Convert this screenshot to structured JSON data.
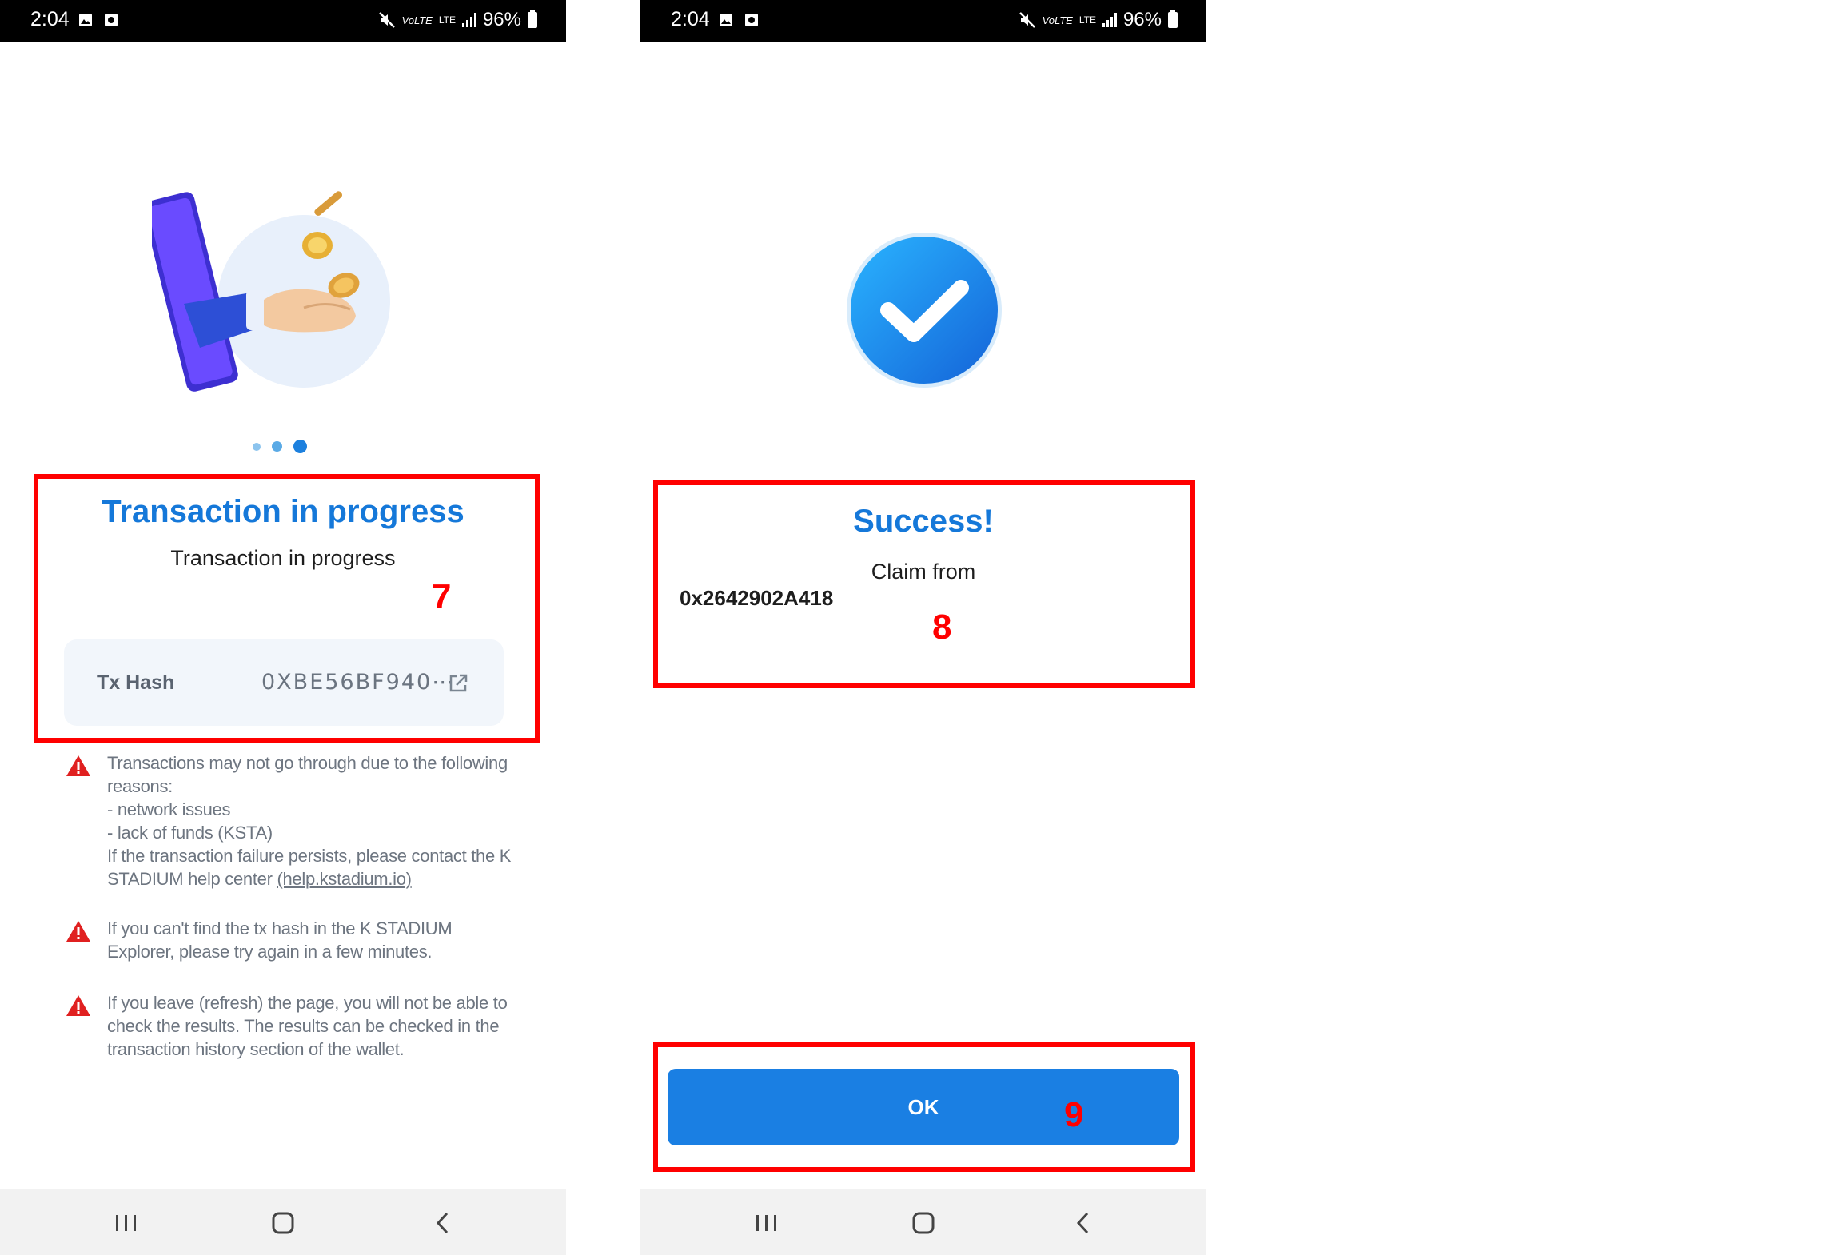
{
  "status_bar": {
    "time": "2:04",
    "volte": "VoLTE",
    "lte": "LTE",
    "battery": "96%"
  },
  "left_screen": {
    "title": "Transaction in progress",
    "subtitle": "Transaction in progress",
    "annotation": "7",
    "tx_hash_label": "Tx Hash",
    "tx_hash_value": "0XBE56BF940⋯",
    "warnings": [
      {
        "text": "Transactions may not go through due to the following reasons:\n- network issues\n- lack of funds (KSTA)\nIf the transaction failure persists, please contact the K STADIUM help center ",
        "link": "(help.kstadium.io)"
      },
      {
        "text": "If you can't find the tx hash in the K STADIUM Explorer, please try again in a few minutes."
      },
      {
        "text": "If you leave (refresh) the page, you will not be able to check the results. The results can be checked in the transaction history section of the wallet."
      }
    ],
    "carousel_active_index": 2,
    "carousel_count": 3
  },
  "right_screen": {
    "title": "Success!",
    "subtitle": "Claim from",
    "address": "0x2642902A418",
    "annotation": "8",
    "ok_label": "OK",
    "ok_annotation": "9"
  },
  "colors": {
    "accent": "#1578d9",
    "button": "#1a7fe3",
    "annotation_red": "#ff0000",
    "warning_red": "#e02020"
  },
  "icons": [
    "gallery-icon",
    "screenshot-icon",
    "mute-icon",
    "signal-icon",
    "battery-icon",
    "external-link-icon",
    "warning-icon",
    "check-circle-icon",
    "recents-icon",
    "home-icon",
    "back-icon"
  ]
}
